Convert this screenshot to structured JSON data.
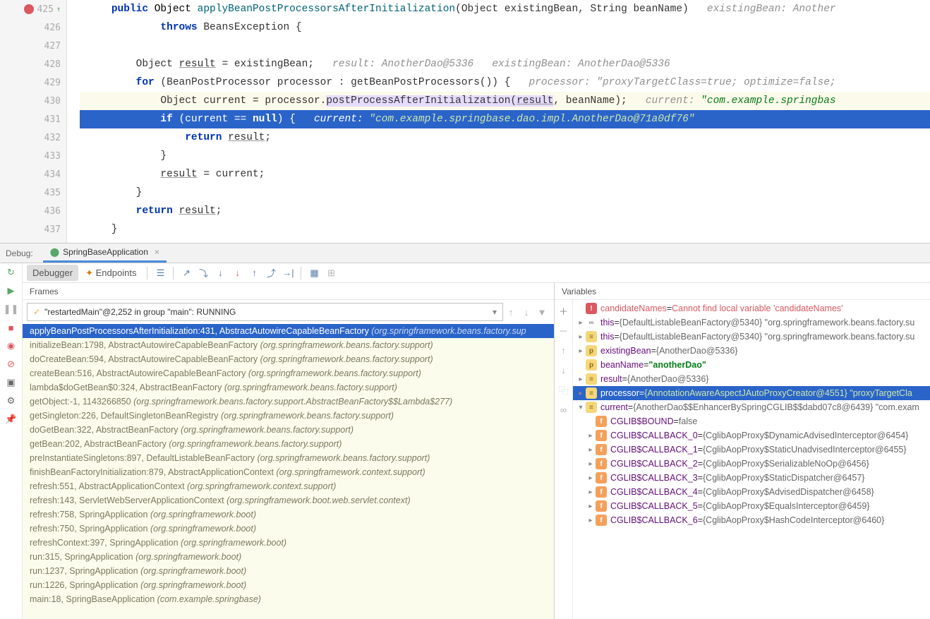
{
  "editor": {
    "lines": [
      {
        "num": "425",
        "breakpoint": true,
        "arrow": true,
        "code": [
          {
            "t": "    ",
            "c": ""
          },
          {
            "t": "public",
            "c": "kw"
          },
          {
            "t": " Object ",
            "c": "type"
          },
          {
            "t": "applyBeanPostProcessorsAfterInitialization",
            "c": "method"
          },
          {
            "t": "(Object existingBean, String beanName)",
            "c": ""
          }
        ],
        "hint": "existingBean: Another"
      },
      {
        "num": "426",
        "code": [
          {
            "t": "            ",
            "c": ""
          },
          {
            "t": "throws",
            "c": "kw"
          },
          {
            "t": " BeansException {",
            "c": ""
          }
        ]
      },
      {
        "num": "427",
        "code": [
          {
            "t": "",
            "c": ""
          }
        ]
      },
      {
        "num": "428",
        "code": [
          {
            "t": "        Object ",
            "c": ""
          },
          {
            "t": "result",
            "c": "id-u"
          },
          {
            "t": " = existingBean;",
            "c": ""
          }
        ],
        "hint": "result: AnotherDao@5336   existingBean: AnotherDao@5336"
      },
      {
        "num": "429",
        "code": [
          {
            "t": "        ",
            "c": ""
          },
          {
            "t": "for",
            "c": "kw"
          },
          {
            "t": " (BeanPostProcessor processor : getBeanPostProcessors()) {",
            "c": ""
          }
        ],
        "hint": "processor: \"proxyTargetClass=true; optimize=false;"
      },
      {
        "num": "430",
        "current": true,
        "code": [
          {
            "t": "            Object current = processor.",
            "c": ""
          },
          {
            "t": "postProcessAfterInitialization(",
            "c": "call-hl"
          },
          {
            "t": "result",
            "c": "call-hl id-u"
          },
          {
            "t": ", beanName);",
            "c": ""
          }
        ],
        "hint": "current: ",
        "hintStr": "\"com.example.springbas"
      },
      {
        "num": "431",
        "exec": true,
        "code": [
          {
            "t": "            ",
            "c": ""
          },
          {
            "t": "if",
            "c": "kw"
          },
          {
            "t": " (current == ",
            "c": ""
          },
          {
            "t": "null",
            "c": "kw"
          },
          {
            "t": ") {",
            "c": ""
          }
        ],
        "hint": "current: ",
        "hintStr": "\"com.example.springbase.dao.impl.AnotherDao@71a0df76\""
      },
      {
        "num": "432",
        "code": [
          {
            "t": "                ",
            "c": ""
          },
          {
            "t": "return",
            "c": "kw"
          },
          {
            "t": " ",
            "c": ""
          },
          {
            "t": "result",
            "c": "id-u"
          },
          {
            "t": ";",
            "c": ""
          }
        ]
      },
      {
        "num": "433",
        "code": [
          {
            "t": "            }",
            "c": ""
          }
        ]
      },
      {
        "num": "434",
        "code": [
          {
            "t": "            ",
            "c": ""
          },
          {
            "t": "result",
            "c": "id-u"
          },
          {
            "t": " = current;",
            "c": ""
          }
        ]
      },
      {
        "num": "435",
        "code": [
          {
            "t": "        }",
            "c": ""
          }
        ]
      },
      {
        "num": "436",
        "code": [
          {
            "t": "        ",
            "c": ""
          },
          {
            "t": "return",
            "c": "kw"
          },
          {
            "t": " ",
            "c": ""
          },
          {
            "t": "result",
            "c": "id-u"
          },
          {
            "t": ";",
            "c": ""
          }
        ]
      },
      {
        "num": "437",
        "code": [
          {
            "t": "    }",
            "c": ""
          }
        ]
      }
    ]
  },
  "debug": {
    "label": "Debug:",
    "tabName": "SpringBaseApplication",
    "tabs": {
      "debugger": "Debugger",
      "endpoints": "Endpoints"
    },
    "thread": "\"restartedMain\"@2,252 in group \"main\": RUNNING",
    "framesLabel": "Frames",
    "varsLabel": "Variables",
    "frames": [
      {
        "m": "applyBeanPostProcessorsAfterInitialization:431, AbstractAutowireCapableBeanFactory ",
        "p": "(org.springframework.beans.factory.sup",
        "sel": true
      },
      {
        "m": "initializeBean:1798, AbstractAutowireCapableBeanFactory ",
        "p": "(org.springframework.beans.factory.support)"
      },
      {
        "m": "doCreateBean:594, AbstractAutowireCapableBeanFactory ",
        "p": "(org.springframework.beans.factory.support)"
      },
      {
        "m": "createBean:516, AbstractAutowireCapableBeanFactory ",
        "p": "(org.springframework.beans.factory.support)"
      },
      {
        "m": "lambda$doGetBean$0:324, AbstractBeanFactory ",
        "p": "(org.springframework.beans.factory.support)"
      },
      {
        "m": "getObject:-1, 1143266850 ",
        "p": "(org.springframework.beans.factory.support.AbstractBeanFactory$$Lambda$277)"
      },
      {
        "m": "getSingleton:226, DefaultSingletonBeanRegistry ",
        "p": "(org.springframework.beans.factory.support)"
      },
      {
        "m": "doGetBean:322, AbstractBeanFactory ",
        "p": "(org.springframework.beans.factory.support)"
      },
      {
        "m": "getBean:202, AbstractBeanFactory ",
        "p": "(org.springframework.beans.factory.support)"
      },
      {
        "m": "preInstantiateSingletons:897, DefaultListableBeanFactory ",
        "p": "(org.springframework.beans.factory.support)"
      },
      {
        "m": "finishBeanFactoryInitialization:879, AbstractApplicationContext ",
        "p": "(org.springframework.context.support)"
      },
      {
        "m": "refresh:551, AbstractApplicationContext ",
        "p": "(org.springframework.context.support)"
      },
      {
        "m": "refresh:143, ServletWebServerApplicationContext ",
        "p": "(org.springframework.boot.web.servlet.context)"
      },
      {
        "m": "refresh:758, SpringApplication ",
        "p": "(org.springframework.boot)"
      },
      {
        "m": "refresh:750, SpringApplication ",
        "p": "(org.springframework.boot)"
      },
      {
        "m": "refreshContext:397, SpringApplication ",
        "p": "(org.springframework.boot)"
      },
      {
        "m": "run:315, SpringApplication ",
        "p": "(org.springframework.boot)"
      },
      {
        "m": "run:1237, SpringApplication ",
        "p": "(org.springframework.boot)"
      },
      {
        "m": "run:1226, SpringApplication ",
        "p": "(org.springframework.boot)"
      },
      {
        "m": "main:18, SpringBaseApplication ",
        "p": "(com.example.springbase)"
      }
    ],
    "vars": [
      {
        "icon": "err",
        "exp": "",
        "ind": 0,
        "name": "candidateNames",
        "eq": " = ",
        "val": "Cannot find local variable 'candidateNames'",
        "cls": "verr"
      },
      {
        "icon": "link",
        "exp": "closed",
        "ind": 0,
        "name": "this",
        "eq": " = ",
        "val": "{DefaultListableBeanFactory@5340} \"org.springframework.beans.factory.su",
        "nameCls": "vname"
      },
      {
        "icon": "obj",
        "exp": "closed",
        "ind": 0,
        "name": "this",
        "eq": " = ",
        "val": "{DefaultListableBeanFactory@5340} \"org.springframework.beans.factory.su",
        "nameCls": "vname"
      },
      {
        "icon": "p",
        "exp": "closed",
        "ind": 0,
        "name": "existingBean",
        "eq": " = ",
        "val": "{AnotherDao@5336}",
        "nameCls": "vname"
      },
      {
        "icon": "p",
        "exp": "",
        "ind": 0,
        "name": "beanName",
        "eq": " = ",
        "val": "\"anotherDao\"",
        "nameCls": "vname",
        "valCls": "vstr"
      },
      {
        "icon": "obj",
        "exp": "closed",
        "ind": 0,
        "name": "result",
        "eq": " = ",
        "val": "{AnotherDao@5336}",
        "nameCls": "vname"
      },
      {
        "icon": "obj",
        "exp": "closed",
        "ind": 0,
        "name": "processor",
        "eq": " = ",
        "val": "{AnnotationAwareAspectJAutoProxyCreator@4551} \"proxyTargetCla",
        "sel": true
      },
      {
        "icon": "obj",
        "exp": "open",
        "ind": 0,
        "name": "current",
        "eq": " = ",
        "val": "{AnotherDao$$EnhancerBySpringCGLIB$$dabd07c8@6439} \"com.exam",
        "nameCls": "vname"
      },
      {
        "icon": "f",
        "exp": "",
        "ind": 1,
        "name": "CGLIB$BOUND",
        "eq": " = ",
        "val": "false",
        "nameCls": "vname"
      },
      {
        "icon": "f",
        "exp": "closed",
        "ind": 1,
        "name": "CGLIB$CALLBACK_0",
        "eq": " = ",
        "val": "{CglibAopProxy$DynamicAdvisedInterceptor@6454}",
        "nameCls": "vname"
      },
      {
        "icon": "f",
        "exp": "closed",
        "ind": 1,
        "name": "CGLIB$CALLBACK_1",
        "eq": " = ",
        "val": "{CglibAopProxy$StaticUnadvisedInterceptor@6455}",
        "nameCls": "vname"
      },
      {
        "icon": "f",
        "exp": "closed",
        "ind": 1,
        "name": "CGLIB$CALLBACK_2",
        "eq": " = ",
        "val": "{CglibAopProxy$SerializableNoOp@6456}",
        "nameCls": "vname"
      },
      {
        "icon": "f",
        "exp": "closed",
        "ind": 1,
        "name": "CGLIB$CALLBACK_3",
        "eq": " = ",
        "val": "{CglibAopProxy$StaticDispatcher@6457}",
        "nameCls": "vname"
      },
      {
        "icon": "f",
        "exp": "closed",
        "ind": 1,
        "name": "CGLIB$CALLBACK_4",
        "eq": " = ",
        "val": "{CglibAopProxy$AdvisedDispatcher@6458}",
        "nameCls": "vname"
      },
      {
        "icon": "f",
        "exp": "closed",
        "ind": 1,
        "name": "CGLIB$CALLBACK_5",
        "eq": " = ",
        "val": "{CglibAopProxy$EqualsInterceptor@6459}",
        "nameCls": "vname"
      },
      {
        "icon": "f",
        "exp": "closed",
        "ind": 1,
        "name": "CGLIB$CALLBACK_6",
        "eq": " = ",
        "val": "{CglibAopProxy$HashCodeInterceptor@6460}",
        "nameCls": "vname"
      }
    ]
  }
}
